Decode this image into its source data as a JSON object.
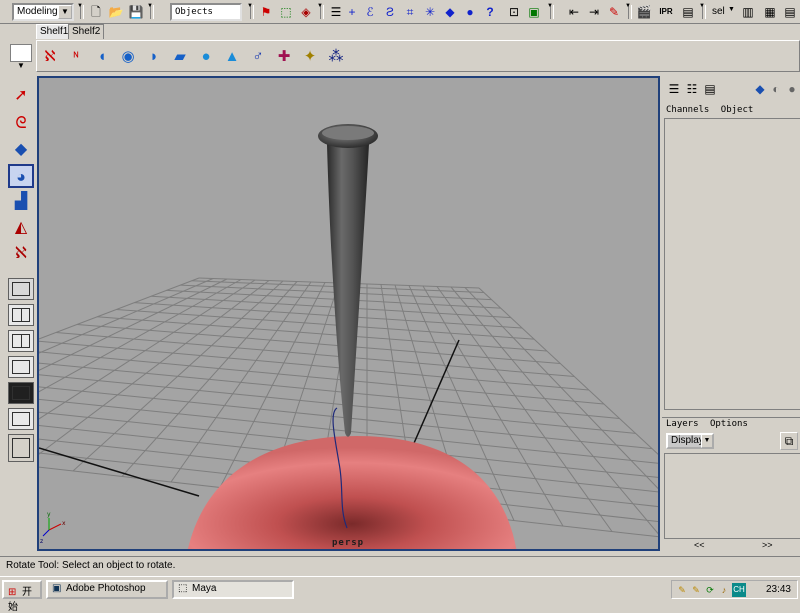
{
  "statusline": {
    "menu_set": "Modeling",
    "selection_mode": "Objects",
    "sel_label": "sel",
    "icons": [
      "new-scene-icon",
      "open-scene-icon",
      "save-scene-icon",
      "select-hierarchy-icon",
      "select-object-icon",
      "select-component-icon",
      "snap-grid-icon",
      "snap-curve-icon",
      "snap-point-icon",
      "snap-view-plane-icon",
      "snap-live-icon",
      "history-icon",
      "render-icon",
      "ipr-render-icon",
      "render-globals-icon"
    ]
  },
  "shelf": {
    "tabs": [
      "Shelf1",
      "Shelf2"
    ],
    "active_tab": "Shelf1"
  },
  "viewport": {
    "camera_label": "persp"
  },
  "channel_box": {
    "menu": [
      "Channels",
      "Object"
    ]
  },
  "layers": {
    "menu": [
      "Layers",
      "Options"
    ],
    "display_value": "Display",
    "scroll_left": "<<",
    "scroll_right": ">>"
  },
  "helpline": {
    "text": "Rotate Tool: Select an object to rotate."
  },
  "taskbar": {
    "start_label": "开始",
    "tasks": [
      {
        "label": "Adobe Photoshop",
        "active": false
      },
      {
        "label": "Maya",
        "active": true
      }
    ],
    "tray_ime": "CH",
    "clock": "23:43"
  },
  "colors": {
    "viewport_bg": "#a4a4a4",
    "viewport_border": "#20407a",
    "sphere": "#d96a6a",
    "spike": "#4a4a4a",
    "curve": "#1f2a7a"
  }
}
